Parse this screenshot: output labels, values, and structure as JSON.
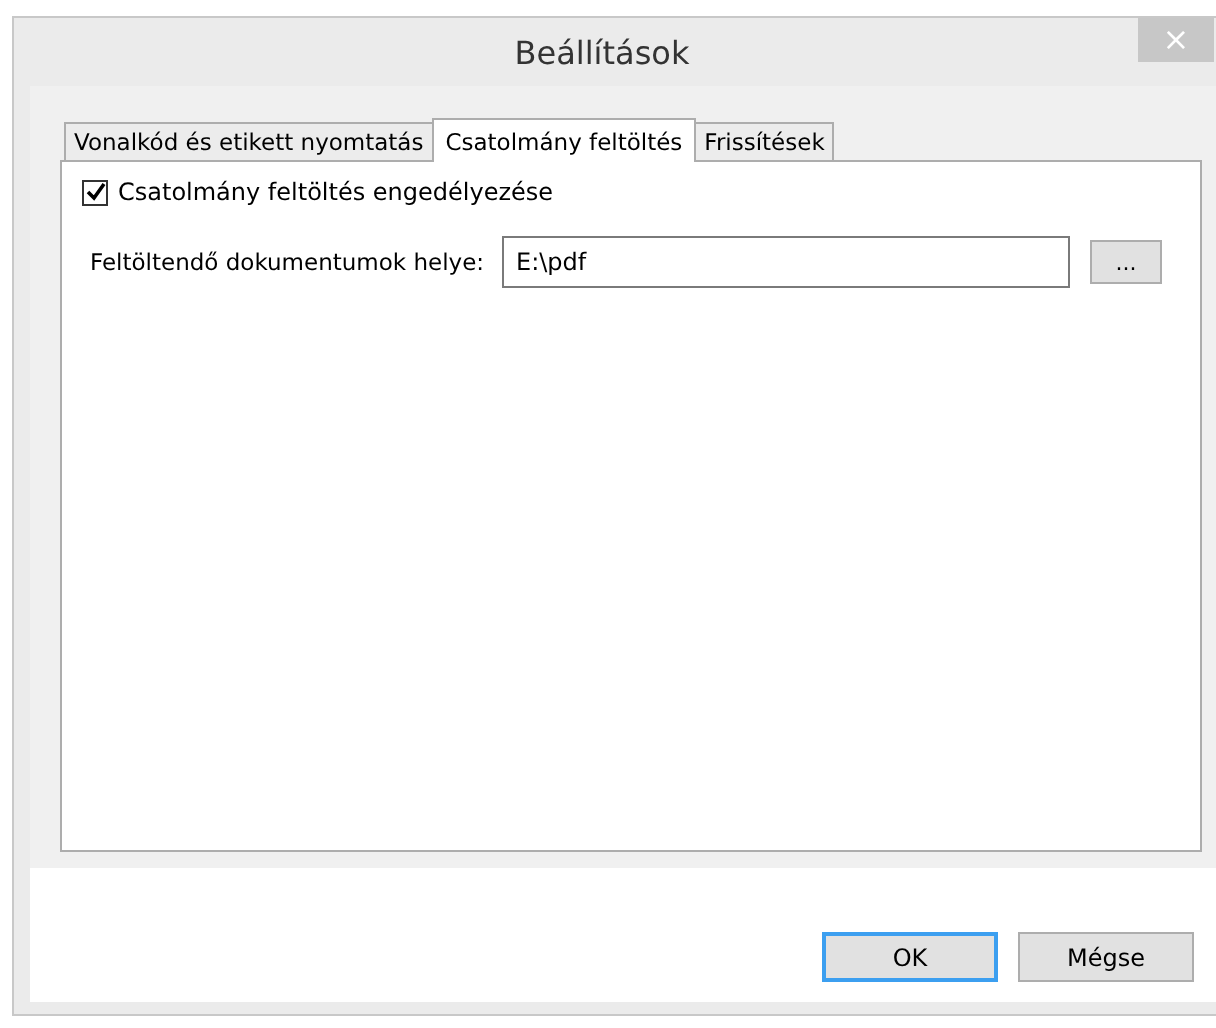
{
  "window": {
    "title": "Beállítások",
    "close": "×"
  },
  "tabs": [
    {
      "label": "Vonalkód és etikett nyomtatás",
      "selected": false
    },
    {
      "label": "Csatolmány feltöltés",
      "selected": true
    },
    {
      "label": "Frissítések",
      "selected": false
    }
  ],
  "enable_checkbox": {
    "label": "Csatolmány feltöltés engedélyezése",
    "checked": true
  },
  "folder_field": {
    "label": "Feltöltendő dokumentumok helye:",
    "value": "E:\\pdf",
    "browse": "..."
  },
  "buttons": [
    {
      "label": "OK",
      "default": true
    },
    {
      "label": "Mégse",
      "default": false
    }
  ]
}
